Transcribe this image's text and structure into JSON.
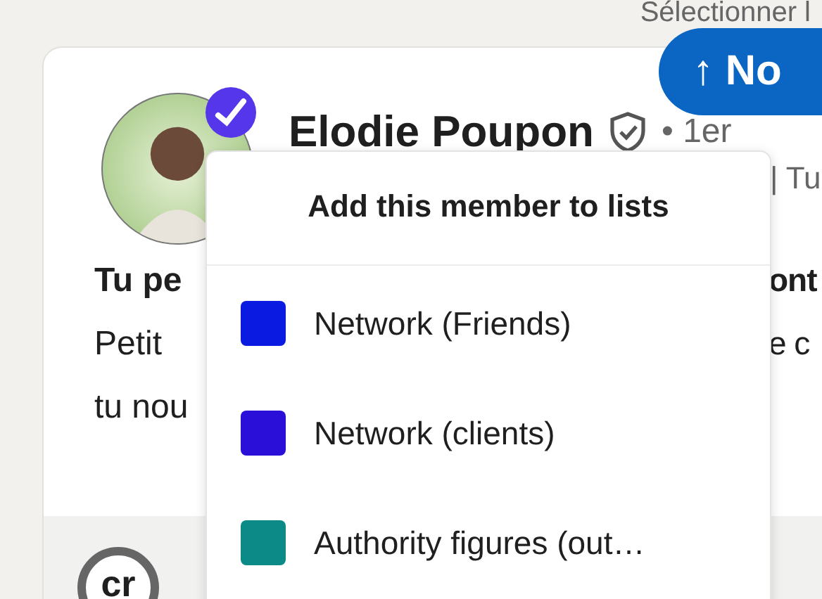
{
  "header": {
    "text": "Sélectionner l"
  },
  "new_posts_button": {
    "label": "↑ No"
  },
  "post": {
    "author": {
      "name": "Elodie Poupon",
      "verified": true,
      "degree": "• 1er",
      "headline": "| Tu"
    },
    "text_lines": [
      {
        "left": "Tu pe",
        "right": "ont",
        "bold": true
      },
      {
        "left": "Petit",
        "right": "e c",
        "bold": false
      },
      {
        "left": "tu nou",
        "bold": false
      }
    ],
    "footer": {
      "avatar_text": "cr"
    }
  },
  "lists_menu": {
    "title": "Add this member to lists",
    "items": [
      {
        "label": "Network (Friends)",
        "color": "#0a1ae0"
      },
      {
        "label": "Network (clients)",
        "color": "#2a0fd9"
      },
      {
        "label": "Authority figures (out…",
        "color": "#0b8a88"
      }
    ]
  }
}
